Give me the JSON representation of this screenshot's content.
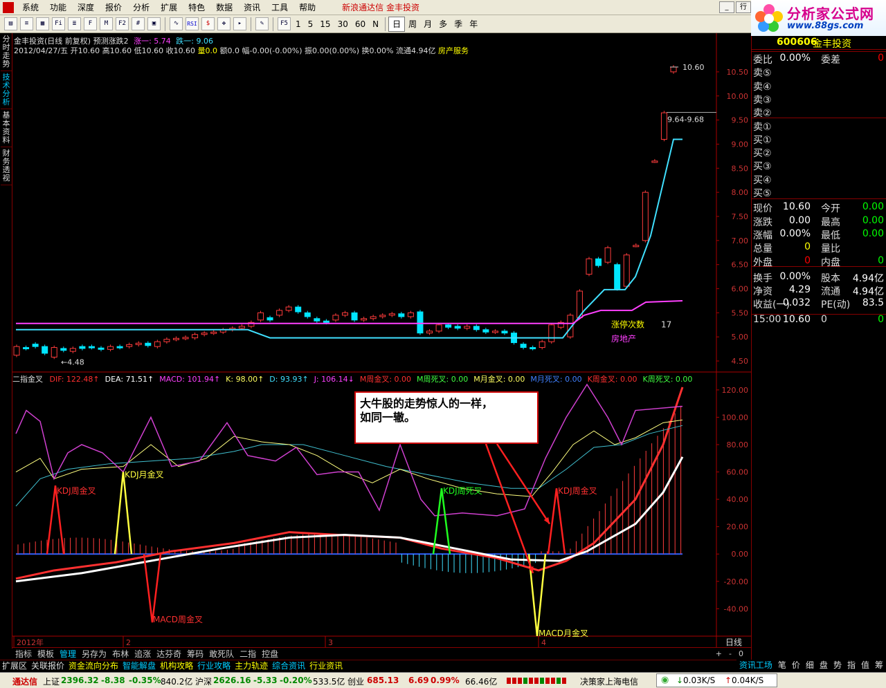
{
  "menu": {
    "items": [
      "系统",
      "功能",
      "深度",
      "报价",
      "分析",
      "扩展",
      "特色",
      "数据",
      "资讯",
      "工具",
      "帮助"
    ],
    "brand": "新浪通达信  金丰投资",
    "row_button": "行"
  },
  "toolbar": {
    "icon_buttons": [
      "chart",
      "list",
      "grid",
      "fin",
      "ind",
      "f10",
      "mfl",
      "f2",
      "cal",
      "img",
      "rsi",
      "cash",
      "move",
      "sel",
      "pen"
    ],
    "f5": "F5",
    "periods": [
      "1",
      "5",
      "15",
      "30",
      "60"
    ],
    "n_label": "N",
    "day_periods": [
      "日",
      "周",
      "月",
      "多",
      "季",
      "年"
    ],
    "active_period": "日"
  },
  "logo": {
    "title": "分析家公式网",
    "url": "www.88gs.com"
  },
  "left_tabs": [
    {
      "label": "分时走势",
      "active": false
    },
    {
      "label": "技术分析",
      "active": true
    },
    {
      "label": "基本资料",
      "active": false
    },
    {
      "label": "财务透视",
      "active": false
    }
  ],
  "chart": {
    "header1_a": "金丰投资(日线 前复权) 预测涨跌2",
    "header1_b": "涨一: 5.74",
    "header1_c": "跌一: 9.06",
    "header2_a": "2012/04/27/五 开10.60 高10.60 低10.60 收10.60",
    "header2_b": "量0.0",
    "header2_c": "额0.0 幅-0.00(-0.00%) 振0.00(0.00%) 换0.00% 流通4.94亿",
    "header2_d": "房产服务",
    "price_max_label": "10.60",
    "price_range_label": "9.64-9.68",
    "price_min_label": "4.48",
    "zt_label": "涨停次数",
    "zt_value": "17",
    "sector_label": "房地产",
    "y_ticks": [
      "10.50",
      "10.00",
      "9.50",
      "9.00",
      "8.50",
      "8.00",
      "7.50",
      "7.00",
      "6.50",
      "6.00",
      "5.50",
      "5.00",
      "4.50"
    ],
    "ind_name": "二指金叉",
    "ind_items": [
      {
        "t": "DIF: 122.48↑",
        "c": "#ff3030"
      },
      {
        "t": "DEA: 71.51↑",
        "c": "#ffffff"
      },
      {
        "t": "MACD: 101.94↑",
        "c": "#ff40ff"
      },
      {
        "t": "K: 98.00↑",
        "c": "#ffff60"
      },
      {
        "t": "D: 93.93↑",
        "c": "#40e0ff"
      },
      {
        "t": "J: 106.14↓",
        "c": "#ff40ff"
      },
      {
        "t": "M周金叉: 0.00",
        "c": "#ff3030"
      },
      {
        "t": "M周死叉: 0.00",
        "c": "#40ff40"
      },
      {
        "t": "M月金叉: 0.00",
        "c": "#ffff60"
      },
      {
        "t": "M月死叉: 0.00",
        "c": "#4080ff"
      },
      {
        "t": "K周金叉: 0.00",
        "c": "#ff3030"
      },
      {
        "t": "K周死叉: 0.00",
        "c": "#40ff40"
      }
    ],
    "ind_y_ticks": [
      "120.00",
      "100.00",
      "80.00",
      "60.00",
      "40.00",
      "20.00",
      "0.00",
      "-20.00",
      "-40.00"
    ],
    "annot_kdj_week_gold_1": "KDJ周金叉",
    "annot_kdj_month_gold": "KDJ月金叉",
    "annot_kdj_week_dead": "KDJ周死叉",
    "annot_kdj_week_gold_2": "KDJ周金叉",
    "annot_macd_week_gold": "MACD周金叉",
    "annot_macd_month_gold": "MACD月金叉",
    "callout_line1": "大牛股的走势惊人的一样，",
    "callout_line2": "如同一辙。",
    "x_labels": [
      "2012年",
      "2",
      "3",
      "4"
    ],
    "period_label": "日线",
    "zoom_plus": "+",
    "zoom_minus": "-",
    "zoom_zero": "0"
  },
  "chart_data": {
    "type": "candlestick",
    "price_ylim": [
      4.3,
      10.8
    ],
    "indicator_ylim": [
      -55,
      125
    ],
    "candles": [
      {
        "o": 4.62,
        "c": 4.8
      },
      {
        "o": 4.78,
        "c": 4.76
      },
      {
        "o": 4.85,
        "c": 4.8
      },
      {
        "o": 4.8,
        "c": 4.66
      },
      {
        "o": 4.58,
        "c": 4.78
      },
      {
        "o": 4.76,
        "c": 4.72
      },
      {
        "o": 4.7,
        "c": 4.76
      },
      {
        "o": 4.8,
        "c": 4.76
      },
      {
        "o": 4.8,
        "c": 4.78
      },
      {
        "o": 4.77,
        "c": 4.74
      },
      {
        "o": 4.74,
        "c": 4.8
      },
      {
        "o": 4.8,
        "c": 4.78
      },
      {
        "o": 4.8,
        "c": 4.84
      },
      {
        "o": 4.84,
        "c": 4.87
      },
      {
        "o": 4.87,
        "c": 4.82
      },
      {
        "o": 4.8,
        "c": 4.9
      },
      {
        "o": 4.9,
        "c": 4.95
      },
      {
        "o": 4.95,
        "c": 4.97
      },
      {
        "o": 4.97,
        "c": 4.99
      },
      {
        "o": 4.98,
        "c": 5.05
      },
      {
        "o": 5.05,
        "c": 5.08
      },
      {
        "o": 5.08,
        "c": 5.1
      },
      {
        "o": 5.1,
        "c": 5.15
      },
      {
        "o": 5.15,
        "c": 5.18
      },
      {
        "o": 5.18,
        "c": 5.22
      },
      {
        "o": 5.22,
        "c": 5.3
      },
      {
        "o": 5.35,
        "c": 5.5
      },
      {
        "o": 5.4,
        "c": 5.35
      },
      {
        "o": 5.45,
        "c": 5.55
      },
      {
        "o": 5.55,
        "c": 5.62
      },
      {
        "o": 5.62,
        "c": 5.52
      },
      {
        "o": 5.5,
        "c": 5.42
      },
      {
        "o": 5.38,
        "c": 5.33
      },
      {
        "o": 5.33,
        "c": 5.3
      },
      {
        "o": 5.35,
        "c": 5.45
      },
      {
        "o": 5.45,
        "c": 5.5
      },
      {
        "o": 5.5,
        "c": 5.35
      },
      {
        "o": 5.35,
        "c": 5.38
      },
      {
        "o": 5.38,
        "c": 5.42
      },
      {
        "o": 5.42,
        "c": 5.45
      },
      {
        "o": 5.45,
        "c": 5.48
      },
      {
        "o": 5.48,
        "c": 5.42
      },
      {
        "o": 5.42,
        "c": 5.5
      },
      {
        "o": 5.52,
        "c": 5.08
      },
      {
        "o": 5.08,
        "c": 5.12
      },
      {
        "o": 5.12,
        "c": 5.25
      },
      {
        "o": 5.25,
        "c": 5.2
      },
      {
        "o": 5.22,
        "c": 5.18
      },
      {
        "o": 5.18,
        "c": 5.22
      },
      {
        "o": 5.22,
        "c": 5.15
      },
      {
        "o": 5.15,
        "c": 5.1
      },
      {
        "o": 5.1,
        "c": 5.12
      },
      {
        "o": 5.12,
        "c": 5.08
      },
      {
        "o": 5.08,
        "c": 4.88
      },
      {
        "o": 4.85,
        "c": 4.78
      },
      {
        "o": 4.78,
        "c": 4.76
      },
      {
        "o": 4.78,
        "c": 4.9
      },
      {
        "o": 4.9,
        "c": 5.25
      },
      {
        "o": 5.2,
        "c": 5.3
      },
      {
        "o": 5.0,
        "c": 5.45
      },
      {
        "o": 5.4,
        "c": 5.95
      },
      {
        "o": 6.3,
        "c": 6.62
      },
      {
        "o": 6.62,
        "c": 6.48
      },
      {
        "o": 6.55,
        "c": 6.85
      },
      {
        "o": 6.5,
        "c": 6.0
      },
      {
        "o": 6.05,
        "c": 6.7
      },
      {
        "o": 6.9,
        "c": 6.9
      },
      {
        "o": 7.0,
        "c": 8.0
      },
      {
        "o": 8.65,
        "c": 8.65
      },
      {
        "o": 9.1,
        "c": 9.65
      },
      {
        "o": 10.5,
        "c": 10.6
      }
    ],
    "support_line": "cyan stepped support line",
    "ma_line": "magenta average line"
  },
  "quote": {
    "code": "600606",
    "name": "金丰投资",
    "rows": [
      {
        "l": "委比",
        "v": "0.00%",
        "l2": "委差",
        "v2": "0",
        "vc": "#fff",
        "v2c": "#f00"
      },
      {
        "l": "卖⑤",
        "v": "",
        "l2": "",
        "v2": ""
      },
      {
        "l": "卖④",
        "v": "",
        "l2": "",
        "v2": ""
      },
      {
        "l": "卖③",
        "v": "",
        "l2": "",
        "v2": ""
      },
      {
        "l": "卖②",
        "v": "",
        "l2": "",
        "v2": ""
      },
      {
        "l": "卖①",
        "v": "",
        "l2": "",
        "v2": ""
      },
      {
        "l": "买①",
        "v": "",
        "l2": "",
        "v2": ""
      },
      {
        "l": "买②",
        "v": "",
        "l2": "",
        "v2": ""
      },
      {
        "l": "买③",
        "v": "",
        "l2": "",
        "v2": ""
      },
      {
        "l": "买④",
        "v": "",
        "l2": "",
        "v2": ""
      },
      {
        "l": "买⑤",
        "v": "",
        "l2": "",
        "v2": ""
      },
      {
        "l": "现价",
        "v": "10.60",
        "l2": "今开",
        "v2": "0.00",
        "vc": "#fff",
        "v2c": "#0f0"
      },
      {
        "l": "涨跌",
        "v": "0.00",
        "l2": "最高",
        "v2": "0.00",
        "vc": "#fff",
        "v2c": "#0f0"
      },
      {
        "l": "涨幅",
        "v": "0.00%",
        "l2": "最低",
        "v2": "0.00",
        "vc": "#fff",
        "v2c": "#0f0"
      },
      {
        "l": "总量",
        "v": "0",
        "l2": "量比",
        "v2": "",
        "vc": "#ff0",
        "v2c": "#fff"
      },
      {
        "l": "外盘",
        "v": "0",
        "l2": "内盘",
        "v2": "0",
        "vc": "#f00",
        "v2c": "#0f0"
      },
      {
        "l": "换手",
        "v": "0.00%",
        "l2": "股本",
        "v2": "4.94亿",
        "vc": "#fff",
        "v2c": "#fff"
      },
      {
        "l": "净资",
        "v": "4.29",
        "l2": "流通",
        "v2": "4.94亿",
        "vc": "#fff",
        "v2c": "#fff"
      },
      {
        "l": "收益(一)",
        "v": "0.032",
        "l2": "PE(动)",
        "v2": "83.5",
        "vc": "#fff",
        "v2c": "#fff"
      },
      {
        "l": "15:00",
        "v": "10.60",
        "l2": "0",
        "v2": "0",
        "vc": "#fff",
        "v2c": "#0f0"
      }
    ]
  },
  "bottom_tabs": [
    "指标",
    "模板",
    "管理",
    "另存为",
    "布林",
    "追涨",
    "达芬奇",
    "筹码",
    "敢死队",
    "二指",
    "控盘"
  ],
  "bottom_tabs_active": "管理",
  "ext_tabs": [
    "扩展区",
    "关联报价",
    "资金流向分布",
    "智能解盘",
    "机构攻略",
    "行业攻略",
    "主力轨迹",
    "综合资讯",
    "行业资讯"
  ],
  "right_tabs": [
    "资讯工场",
    "笔",
    "价",
    "细",
    "盘",
    "势",
    "指",
    "值",
    "筹"
  ],
  "status": {
    "app": "通达信",
    "sh_label": "上证",
    "sh_val": "2396.32",
    "sh_chg": "-8.38",
    "sh_pct": "-0.35%",
    "sh_amt": "840.2亿",
    "sz_label": "沪深",
    "sz_val": "2626.16",
    "sz_chg": "-5.33",
    "sz_pct": "-0.20%",
    "sz_amt": "533.5亿",
    "cy_label": "创业",
    "cy_val": "685.13",
    "cy_chg": "6.69",
    "cy_pct": "0.99%",
    "cy_amt": "66.46亿",
    "broker": "决策家上海电信",
    "net_down": "0.03K/S",
    "net_up": "0.04K/S"
  }
}
